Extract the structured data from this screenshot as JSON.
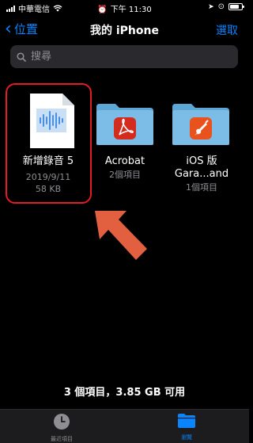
{
  "status_bar": {
    "carrier": "中華電信",
    "time": "下午 11:30"
  },
  "nav": {
    "back_label": "位置",
    "title": "我的 iPhone",
    "select_label": "選取"
  },
  "search": {
    "placeholder": "搜尋"
  },
  "files": [
    {
      "name": "新增錄音 5",
      "date": "2019/9/11",
      "size": "58 KB",
      "icon": "audio-document-icon"
    },
    {
      "name": "Acrobat",
      "meta": "2個項目",
      "icon": "acrobat-folder-icon"
    },
    {
      "name_line1": "iOS 版",
      "name_line2": "Gara...and",
      "meta": "1個項目",
      "icon": "garageband-folder-icon"
    }
  ],
  "footer": {
    "summary": "3 個項目，3.85 GB 可用"
  },
  "tabs": [
    {
      "label": "最近項目",
      "icon": "clock-icon",
      "active": false
    },
    {
      "label": "瀏覽",
      "icon": "folder-icon",
      "active": true
    }
  ],
  "colors": {
    "accent": "#0a84ff",
    "highlight": "#e31b23",
    "arrow": "#e2603f",
    "folder": "#74b7df",
    "acrobat": "#d32b1e",
    "garageband": "#e9521d"
  }
}
